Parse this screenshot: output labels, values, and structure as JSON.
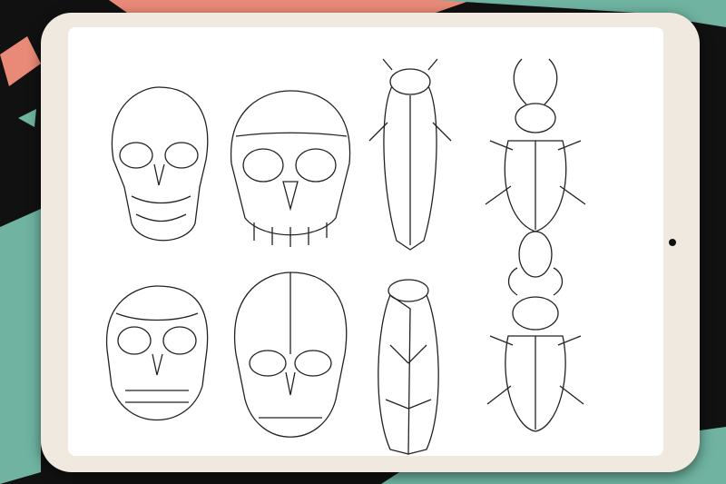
{
  "colors": {
    "background": "#111111",
    "brush_pink": "#e98a78",
    "brush_teal": "#6fb3a0",
    "tablet_frame": "#efe9df",
    "screen": "#ffffff",
    "line_art": "#222222"
  }
}
